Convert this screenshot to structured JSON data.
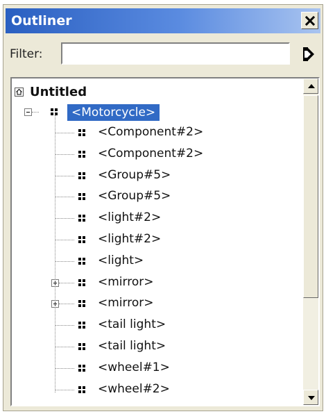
{
  "panel": {
    "title": "Outliner",
    "close_symbol": "✕"
  },
  "filter": {
    "label": "Filter:",
    "value": "",
    "placeholder": ""
  },
  "tree": {
    "root": {
      "label": "Untitled",
      "icon": "scene-icon"
    },
    "selected": {
      "label": "<Motorcycle>",
      "expanded": true
    },
    "children": [
      {
        "label": "<Component#2>",
        "expandable": false
      },
      {
        "label": "<Component#2>",
        "expandable": false
      },
      {
        "label": "<Group#5>",
        "expandable": false
      },
      {
        "label": "<Group#5>",
        "expandable": false
      },
      {
        "label": "<light#2>",
        "expandable": false
      },
      {
        "label": "<light#2>",
        "expandable": false
      },
      {
        "label": "<light>",
        "expandable": false
      },
      {
        "label": "<mirror>",
        "expandable": true
      },
      {
        "label": "<mirror>",
        "expandable": true
      },
      {
        "label": "<tail light>",
        "expandable": false
      },
      {
        "label": "<tail light>",
        "expandable": false
      },
      {
        "label": "<wheel#1>",
        "expandable": false
      },
      {
        "label": "<wheel#2>",
        "expandable": false
      }
    ]
  },
  "colors": {
    "selection": "#316ac5",
    "panel_bg": "#ece9d8",
    "title_gradient_start": "#2a5fc1"
  }
}
